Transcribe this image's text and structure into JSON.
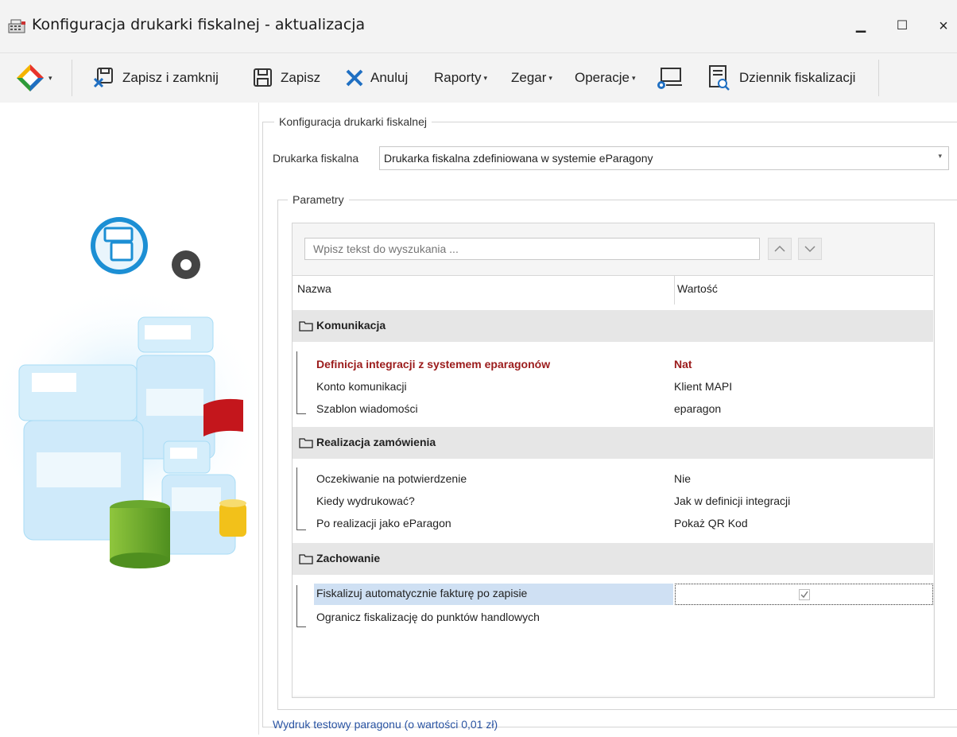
{
  "window": {
    "title": "Konfiguracja drukarki fiskalnej - aktualizacja",
    "minimize": "▁",
    "maximize": "☐",
    "close": "×"
  },
  "toolbar": {
    "save_close": "Zapisz i zamknij",
    "save": "Zapisz",
    "cancel": "Anuluj",
    "reports": "Raporty",
    "clock": "Zegar",
    "operations": "Operacje",
    "journal": "Dziennik fiskalizacji",
    "dropdown_glyph": "▾"
  },
  "config": {
    "group_title": "Konfiguracja drukarki fiskalnej",
    "printer_label": "Drukarka fiskalna",
    "printer_value": "Drukarka fiskalna zdefiniowana w systemie eParagony",
    "combo_arrow": "▾"
  },
  "params": {
    "group_title": "Parametry",
    "search_placeholder": "Wpisz tekst do wyszukania ...",
    "col_name": "Nazwa",
    "col_value": "Wartość",
    "categories": [
      {
        "label": "Komunikacja",
        "rows": [
          {
            "name": "Definicja integracji z systemem eparagonów",
            "value": "Nat",
            "required": true
          },
          {
            "name": "Konto komunikacji",
            "value": "Klient MAPI"
          },
          {
            "name": "Szablon wiadomości",
            "value": "eparagon"
          }
        ]
      },
      {
        "label": "Realizacja zamówienia",
        "rows": [
          {
            "name": "Oczekiwanie na potwierdzenie",
            "value": "Nie"
          },
          {
            "name": "Kiedy wydrukować?",
            "value": "Jak w definicji integracji"
          },
          {
            "name": "Po realizacji jako eParagon",
            "value": "Pokaż QR Kod"
          }
        ]
      },
      {
        "label": "Zachowanie",
        "rows": [
          {
            "name": "Fiskalizuj automatycznie fakturę po zapisie",
            "value": "",
            "checked": true,
            "selected": true
          },
          {
            "name": "Ogranicz fiskalizację do punktów handlowych",
            "value": ""
          }
        ]
      }
    ]
  },
  "footer": {
    "test_print_link": "Wydruk testowy paragonu (o wartości 0,01 zł)"
  },
  "colors": {
    "required_text": "#9b1b1b",
    "selection": "#cfe0f3",
    "link": "#2a54a3",
    "category_bg": "#e6e6e6"
  }
}
